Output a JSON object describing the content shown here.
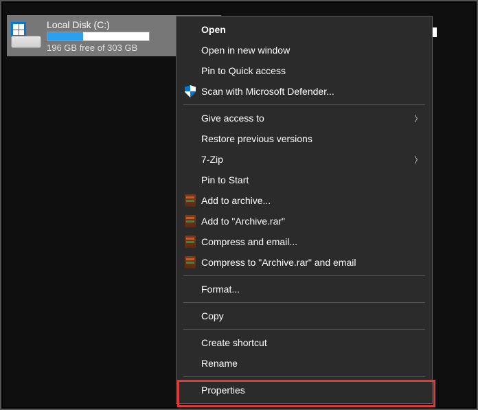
{
  "drive": {
    "name": "Local Disk (C:)",
    "free_text": "196 GB free of 303 GB",
    "fill_percent": 35
  },
  "menu": {
    "items": [
      {
        "label": "Open",
        "bold": true
      },
      {
        "label": "Open in new window"
      },
      {
        "label": "Pin to Quick access"
      },
      {
        "label": "Scan with Microsoft Defender...",
        "icon": "shield"
      },
      {
        "sep": true
      },
      {
        "label": "Give access to",
        "submenu": true
      },
      {
        "label": "Restore previous versions"
      },
      {
        "label": "7-Zip",
        "submenu": true
      },
      {
        "label": "Pin to Start"
      },
      {
        "label": "Add to archive...",
        "icon": "rar"
      },
      {
        "label": "Add to \"Archive.rar\"",
        "icon": "rar"
      },
      {
        "label": "Compress and email...",
        "icon": "rar"
      },
      {
        "label": "Compress to \"Archive.rar\" and email",
        "icon": "rar"
      },
      {
        "sep": true
      },
      {
        "label": "Format..."
      },
      {
        "sep": true
      },
      {
        "label": "Copy"
      },
      {
        "sep": true
      },
      {
        "label": "Create shortcut"
      },
      {
        "label": "Rename"
      },
      {
        "sep": true
      },
      {
        "label": "Properties",
        "highlight": true
      }
    ]
  }
}
